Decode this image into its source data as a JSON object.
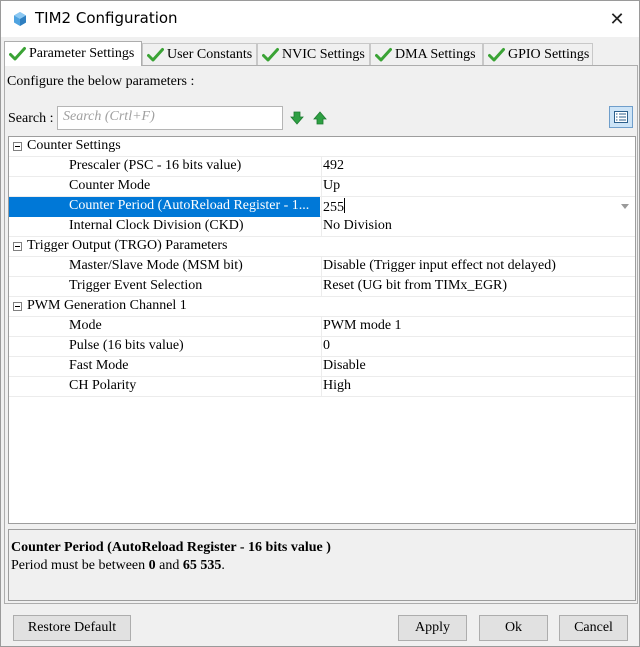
{
  "window": {
    "title": "TIM2 Configuration",
    "icon": "cube-icon",
    "close_glyph": "✕"
  },
  "tabs": [
    {
      "label": "Parameter Settings",
      "active": true
    },
    {
      "label": "User Constants",
      "active": false
    },
    {
      "label": "NVIC Settings",
      "active": false
    },
    {
      "label": "DMA Settings",
      "active": false
    },
    {
      "label": "GPIO Settings",
      "active": false
    }
  ],
  "panel": {
    "configure_label": "Configure the below parameters :",
    "search_label": "Search :",
    "search_placeholder": "Search (Crtl+F)"
  },
  "groups": {
    "counter": {
      "title": "Counter Settings",
      "rows": [
        {
          "name": "Prescaler (PSC - 16 bits value)",
          "value": "492"
        },
        {
          "name": "Counter Mode",
          "value": "Up"
        },
        {
          "name": "Counter Period (AutoReload Register - 1...",
          "value": "255"
        },
        {
          "name": "Internal Clock Division (CKD)",
          "value": "No Division"
        }
      ]
    },
    "trigger": {
      "title": "Trigger Output (TRGO) Parameters",
      "rows": [
        {
          "name": "Master/Slave Mode (MSM bit)",
          "value": "Disable (Trigger input effect not delayed)"
        },
        {
          "name": "Trigger Event Selection",
          "value": "Reset (UG bit from TIMx_EGR)"
        }
      ]
    },
    "pwm": {
      "title": "PWM Generation Channel 1",
      "rows": [
        {
          "name": "Mode",
          "value": "PWM mode 1"
        },
        {
          "name": "Pulse (16 bits value)",
          "value": "0"
        },
        {
          "name": "Fast Mode",
          "value": "Disable"
        },
        {
          "name": "CH Polarity",
          "value": "High"
        }
      ]
    }
  },
  "description": {
    "title": "Counter Period (AutoReload Register - 16 bits value )",
    "text_before": "Period must be between ",
    "min": "0",
    "text_middle": " and ",
    "max": "65 535",
    "text_after": "."
  },
  "buttons": {
    "restore": "Restore Default",
    "apply": "Apply",
    "ok": "Ok",
    "cancel": "Cancel"
  },
  "colors": {
    "selection": "#0078d7",
    "check_green": "#3aa335",
    "arrow_green": "#2ea043"
  }
}
